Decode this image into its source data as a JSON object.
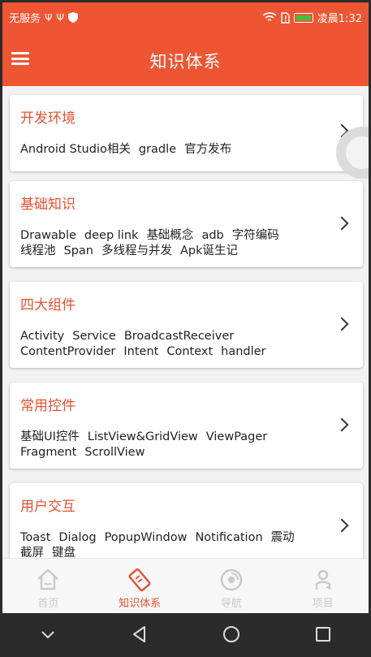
{
  "status_bar": {
    "carrier": "无服务",
    "time": "凌晨1:32"
  },
  "toolbar": {
    "title": "知识体系"
  },
  "cards": [
    {
      "title": "开发环境",
      "tags": [
        "Android Studio相关",
        "gradle",
        "官方发布"
      ]
    },
    {
      "title": "基础知识",
      "tags": [
        "Drawable",
        "deep link",
        "基础概念",
        "adb",
        "字符编码",
        "线程池",
        "Span",
        "多线程与并发",
        "Apk诞生记"
      ]
    },
    {
      "title": "四大组件",
      "tags": [
        "Activity",
        "Service",
        "BroadcastReceiver",
        "ContentProvider",
        "Intent",
        "Context",
        "handler"
      ]
    },
    {
      "title": "常用控件",
      "tags": [
        "基础UI控件",
        "ListView&GridView",
        "ViewPager",
        "Fragment",
        "ScrollView"
      ]
    },
    {
      "title": "用户交互",
      "tags": [
        "Toast",
        "Dialog",
        "PopupWindow",
        "Notification",
        "震动",
        "截屏",
        "键盘"
      ]
    }
  ],
  "tabs": [
    {
      "label": "首页",
      "icon": "home-icon",
      "active": false
    },
    {
      "label": "知识体系",
      "icon": "knowledge-icon",
      "active": true
    },
    {
      "label": "导航",
      "icon": "navigation-icon",
      "active": false
    },
    {
      "label": "项目",
      "icon": "project-icon",
      "active": false
    }
  ],
  "nav_bar": {
    "buttons": [
      "collapse-icon",
      "back-icon",
      "home-circle-icon",
      "recents-icon"
    ]
  },
  "colors": {
    "primary": "#ef5533",
    "accent_text": "#e8512f",
    "inactive_tab": "#c9c9c9"
  }
}
